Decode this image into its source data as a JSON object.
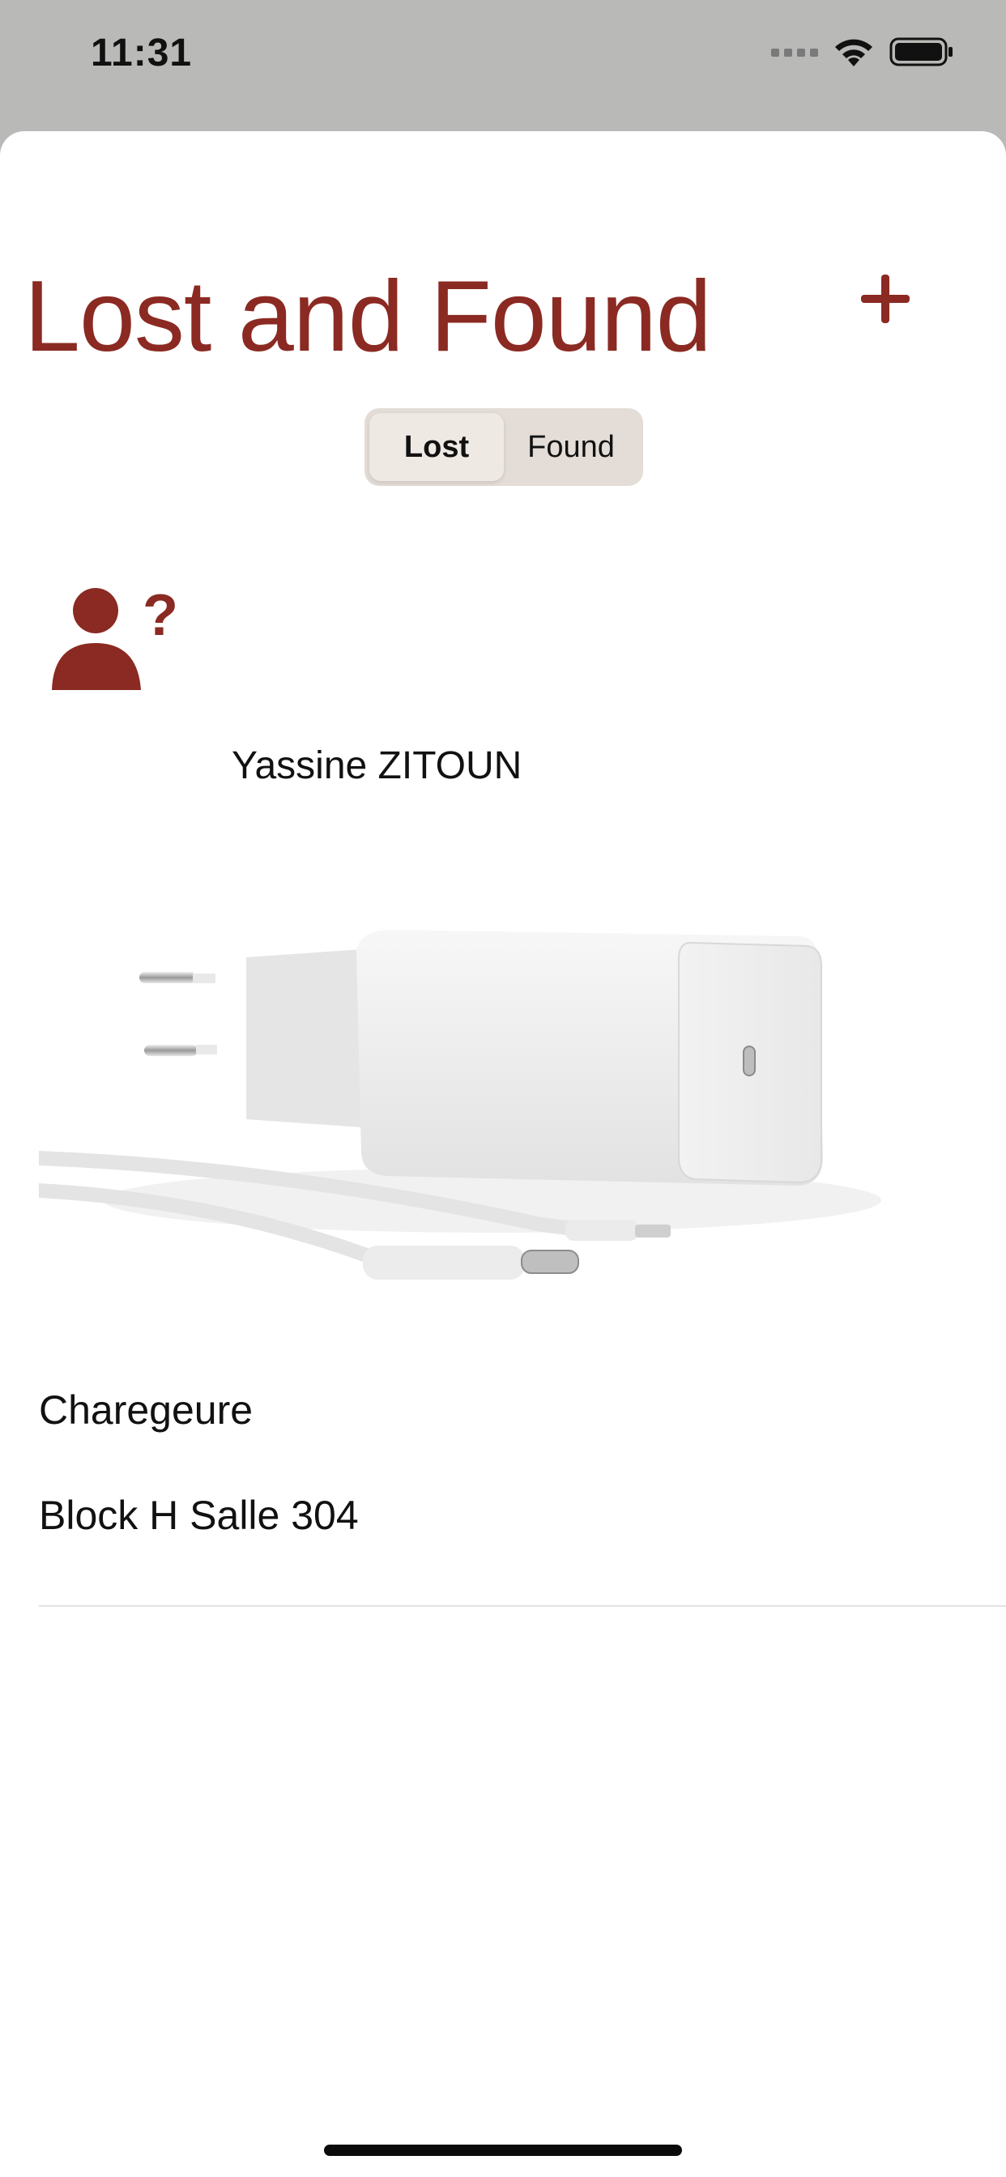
{
  "status_bar": {
    "time": "11:31"
  },
  "header": {
    "title": "Lost and Found",
    "add_icon": "plus-icon"
  },
  "segmented_control": {
    "options": [
      "Lost",
      "Found"
    ],
    "selected": "Lost"
  },
  "post": {
    "user_name": "Yassine ZITOUN",
    "avatar_icon": "person-question-icon",
    "item_name": "Charegeure",
    "location": "Block H Salle 304",
    "image": "charger-photo"
  },
  "colors": {
    "accent": "#8b2a22",
    "segment_bg": "#e4ddd7",
    "status_bar_bg": "#b9bab7"
  }
}
